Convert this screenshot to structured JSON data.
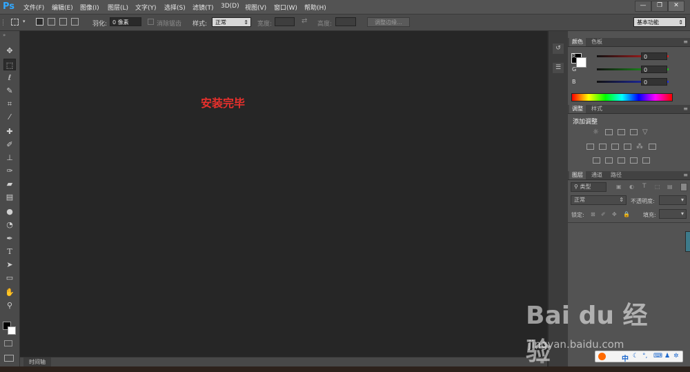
{
  "menu": {
    "logo": "Ps",
    "items": [
      "文件(F)",
      "编辑(E)",
      "图像(I)",
      "图层(L)",
      "文字(Y)",
      "选择(S)",
      "滤镜(T)",
      "3D(D)",
      "视图(V)",
      "窗口(W)",
      "帮助(H)"
    ]
  },
  "window_controls": {
    "minimize": "—",
    "restore": "❐",
    "close": "✕"
  },
  "options": {
    "feather_label": "羽化:",
    "feather_value": "0 像素",
    "antialias_label": "消除锯齿",
    "style_label": "样式:",
    "style_value": "正常",
    "width_label": "宽度:",
    "height_label": "高度:",
    "refine_edge": "调整边缘...",
    "workspace": "基本功能"
  },
  "canvas": {
    "status_text": "安装完毕"
  },
  "timeline": {
    "label": "时间轴"
  },
  "color_panel": {
    "tabs": [
      "颜色",
      "色板"
    ],
    "channels": [
      {
        "name": "R",
        "value": "0",
        "color": "#e02020"
      },
      {
        "name": "G",
        "value": "0",
        "color": "#20c020"
      },
      {
        "name": "B",
        "value": "0",
        "color": "#2030e0"
      }
    ]
  },
  "adjustments_panel": {
    "tabs": [
      "调整",
      "样式"
    ],
    "title": "添加调整"
  },
  "layers_panel": {
    "tabs": [
      "图层",
      "通道",
      "路径"
    ],
    "filter_kind": "类型",
    "blend_mode": "正常",
    "opacity_label": "不透明度:",
    "lock_label": "锁定:",
    "fill_label": "填充:"
  },
  "watermark": {
    "brand": "Bai du 经验",
    "url": "jingyan.baidu.com"
  },
  "ime": {
    "mode": "中"
  },
  "colors": {
    "menubar": "#535353",
    "canvas": "#262626",
    "accent_text": "#e8302c"
  }
}
